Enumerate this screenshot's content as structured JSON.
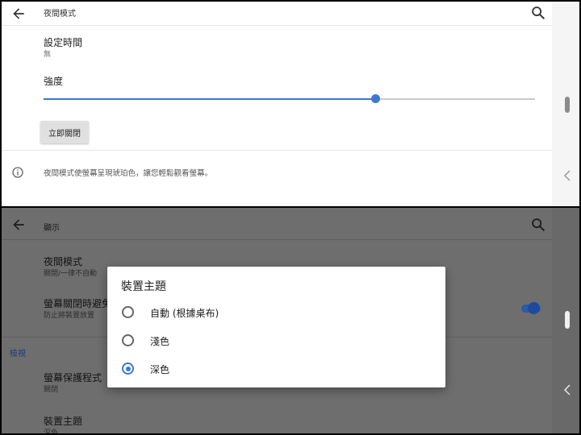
{
  "top_screen": {
    "appbar": {
      "title": "夜間模式"
    },
    "schedule": {
      "title": "設定時間",
      "value": "無"
    },
    "intensity": {
      "title": "強度",
      "level": 0.68
    },
    "action_button": {
      "label": "立即關閉"
    },
    "info": {
      "text": "夜間模式使螢幕呈現琥珀色，讓您輕鬆觀看螢幕。"
    }
  },
  "bottom_screen": {
    "appbar": {
      "title": "顯示"
    },
    "items": [
      {
        "title": "夜間模式",
        "subtitle": "關閉/一律不自動"
      },
      {
        "title": "螢幕關閉時避免",
        "subtitle": "防止將裝置放置"
      }
    ],
    "toggle_on": true,
    "section": {
      "label": "檢視"
    },
    "items2": [
      {
        "title": "螢幕保護程式",
        "subtitle": "關閉"
      },
      {
        "title": "裝置主題",
        "subtitle": "深色"
      }
    ]
  },
  "dialog": {
    "title": "裝置主題",
    "options": [
      {
        "label": "自動 (根據桌布)",
        "selected": false
      },
      {
        "label": "淺色",
        "selected": false
      },
      {
        "label": "深色",
        "selected": true
      }
    ]
  },
  "colors": {
    "accent": "#3f76d1",
    "scrim": "#6e6e6e"
  },
  "icons": [
    "back-arrow-icon",
    "search-icon",
    "info-icon",
    "chevron-left-icon"
  ]
}
